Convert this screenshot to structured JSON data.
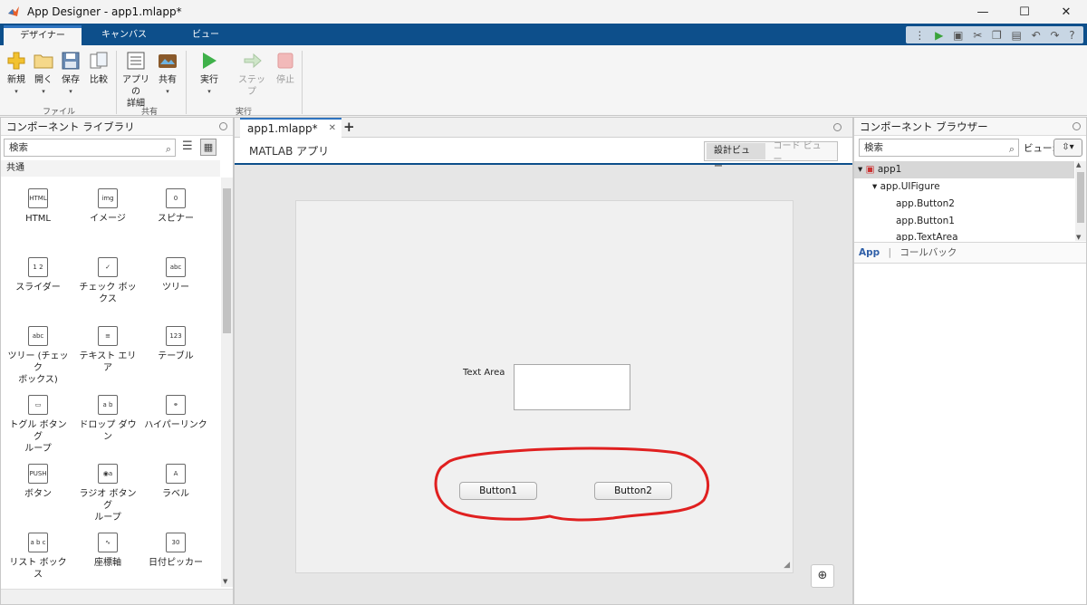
{
  "titlebar": {
    "title": "App Designer - app1.mlapp*",
    "minimize": "—",
    "maximize": "☐",
    "close": "✕"
  },
  "ribbon_tabs": [
    "デザイナー",
    "キャンバス",
    "ビュー"
  ],
  "ribbon": {
    "new": "新規",
    "open": "開く",
    "save": "保存",
    "compare": "比較",
    "app_details_1": "アプリの",
    "app_details_2": "詳細",
    "share": "共有",
    "run": "実行",
    "step": "ステップ",
    "stop": "停止",
    "group_file": "ファイル",
    "group_share": "共有",
    "group_run": "実行"
  },
  "library": {
    "title": "コンポーネント ライブラリ",
    "search_placeholder": "検索",
    "section": "共通",
    "items": [
      {
        "label": "HTML",
        "icon": "HTML"
      },
      {
        "label": "イメージ",
        "icon": "img"
      },
      {
        "label": "スピナー",
        "icon": "0"
      },
      {
        "label": "スライダー",
        "icon": "1 2"
      },
      {
        "label": "チェック ボックス",
        "icon": "✓"
      },
      {
        "label": "ツリー",
        "icon": "abc"
      },
      {
        "label": "ツリー (チェック\nボックス)",
        "icon": "abc"
      },
      {
        "label": "テキスト エリア",
        "icon": "≡"
      },
      {
        "label": "テーブル",
        "icon": "123"
      },
      {
        "label": "トグル ボタン グ\nループ",
        "icon": "▭"
      },
      {
        "label": "ドロップ ダウン",
        "icon": "a b"
      },
      {
        "label": "ハイパーリンク",
        "icon": "⚭"
      },
      {
        "label": "ボタン",
        "icon": "PUSH"
      },
      {
        "label": "ラジオ ボタン グ\nループ",
        "icon": "◉a"
      },
      {
        "label": "ラベル",
        "icon": "A"
      },
      {
        "label": "リスト ボックス",
        "icon": "a b c"
      },
      {
        "label": "座標軸",
        "icon": "∿"
      },
      {
        "label": "日付ピッカー",
        "icon": "30"
      }
    ]
  },
  "doc": {
    "tab": "app1.mlapp*",
    "subtitle": "MATLAB アプリ",
    "design_view": "設計ビュー",
    "code_view": "コード ビュー"
  },
  "canvas": {
    "textarea_label": "Text Area",
    "button1": "Button1",
    "button2": "Button2",
    "annotation_color": "#e02020"
  },
  "browser": {
    "title": "コンポーネント ブラウザー",
    "search_placeholder": "検索",
    "view_label": "ビュー:",
    "tree": [
      "app1",
      "app.UIFigure",
      "app.Button2",
      "app.Button1",
      "app.TextArea"
    ],
    "tab_app": "App",
    "tab_callback": "コールバック"
  }
}
